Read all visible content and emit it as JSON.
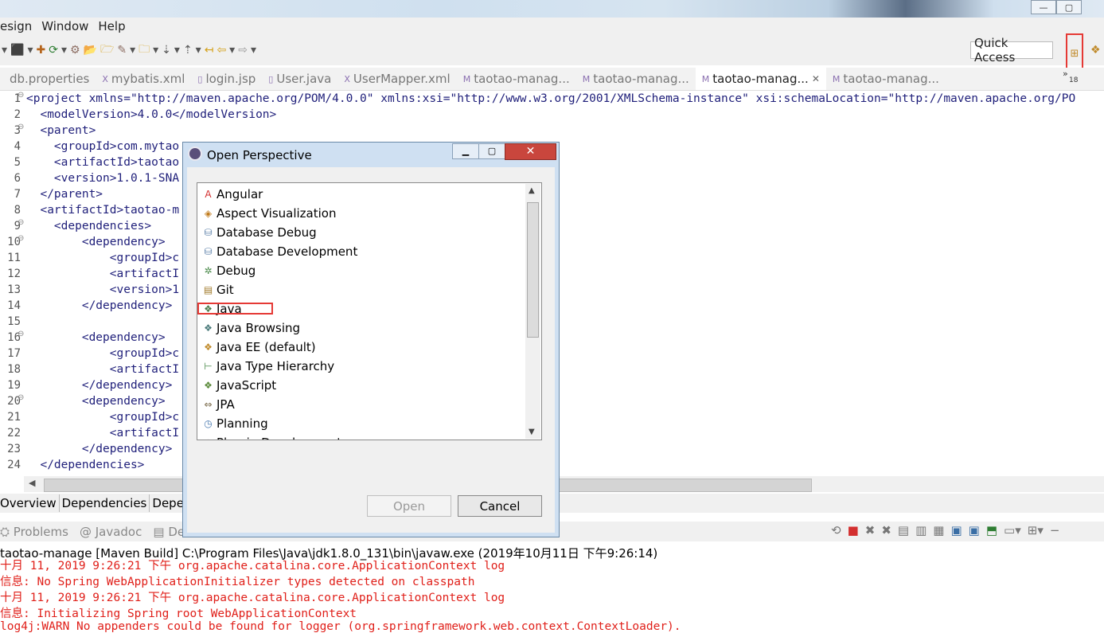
{
  "menu": [
    "esign",
    "Window",
    "Help"
  ],
  "quick_access": "Quick Access",
  "tabs": [
    {
      "label": "db.properties",
      "active": false
    },
    {
      "label": "mybatis.xml",
      "active": false
    },
    {
      "label": "login.jsp",
      "active": false
    },
    {
      "label": "User.java",
      "active": false
    },
    {
      "label": "UserMapper.xml",
      "active": false
    },
    {
      "label": "taotao-manag...",
      "active": false
    },
    {
      "label": "taotao-manag...",
      "active": false
    },
    {
      "label": "taotao-manag...",
      "active": true
    },
    {
      "label": "taotao-manag...",
      "active": false
    }
  ],
  "tab_overflow": "18",
  "editor": {
    "lines": [
      "1",
      "2",
      "3",
      "4",
      "5",
      "6",
      "7",
      "8",
      "9",
      "10",
      "11",
      "12",
      "13",
      "14",
      "15",
      "16",
      "17",
      "18",
      "19",
      "20",
      "21",
      "22",
      "23",
      "24"
    ],
    "code": [
      "<project xmlns=\"http://maven.apache.org/POM/4.0.0\" xmlns:xsi=\"http://www.w3.org/2001/XMLSchema-instance\" xsi:schemaLocation=\"http://maven.apache.org/PO",
      "  <modelVersion>4.0.0</modelVersion>",
      "  <parent>",
      "    <groupId>com.mytao",
      "    <artifactId>taotao",
      "    <version>1.0.1-SNA",
      "  </parent>",
      "  <artifactId>taotao-m",
      "    <dependencies>",
      "        <dependency>",
      "            <groupId>c",
      "            <artifactI",
      "            <version>1",
      "        </dependency>",
      "",
      "        <dependency>",
      "            <groupId>c",
      "            <artifactI",
      "        </dependency>",
      "        <dependency>",
      "            <groupId>c",
      "            <artifactI",
      "        </dependency>",
      "  </dependencies>"
    ]
  },
  "pom_tabs": [
    "Overview",
    "Dependencies",
    "Depe"
  ],
  "console_tabs": [
    "Problems",
    "Javadoc",
    "Dec"
  ],
  "console_title": "taotao-manage [Maven Build] C:\\Program Files\\Java\\jdk1.8.0_131\\bin\\javaw.exe (2019年10月11日 下午9:26:14)",
  "console_lines": [
    "十月 11, 2019 9:26:21 下午 org.apache.catalina.core.ApplicationContext log",
    "信息: No Spring WebApplicationInitializer types detected on classpath",
    "十月 11, 2019 9:26:21 下午 org.apache.catalina.core.ApplicationContext log",
    "信息: Initializing Spring root WebApplicationContext",
    "log4j:WARN No appenders could be found for logger (org.springframework.web.context.ContextLoader)."
  ],
  "dialog": {
    "title": "Open Perspective",
    "items": [
      {
        "label": "Angular",
        "icon": "angular-icon",
        "glyph": "A",
        "color": "#d32f2f"
      },
      {
        "label": "Aspect Visualization",
        "icon": "aspect-icon",
        "glyph": "◈",
        "color": "#c07a1a"
      },
      {
        "label": "Database Debug",
        "icon": "database-debug-icon",
        "glyph": "⛁",
        "color": "#5a7fa8"
      },
      {
        "label": "Database Development",
        "icon": "database-icon",
        "glyph": "⛁",
        "color": "#5a7fa8"
      },
      {
        "label": "Debug",
        "icon": "bug-icon",
        "glyph": "✲",
        "color": "#4a8a4a"
      },
      {
        "label": "Git",
        "icon": "git-icon",
        "glyph": "▤",
        "color": "#a07a2a"
      },
      {
        "label": "Java",
        "icon": "java-icon",
        "glyph": "❖",
        "color": "#4a7a4a"
      },
      {
        "label": "Java Browsing",
        "icon": "java-browsing-icon",
        "glyph": "❖",
        "color": "#4a7a7a"
      },
      {
        "label": "Java EE (default)",
        "icon": "javaee-icon",
        "glyph": "❖",
        "color": "#c08a2a"
      },
      {
        "label": "Java Type Hierarchy",
        "icon": "hierarchy-icon",
        "glyph": "⊢",
        "color": "#4a8a4a"
      },
      {
        "label": "JavaScript",
        "icon": "javascript-icon",
        "glyph": "❖",
        "color": "#5a8a3a"
      },
      {
        "label": "JPA",
        "icon": "jpa-icon",
        "glyph": "⇔",
        "color": "#7a6a4a"
      },
      {
        "label": "Planning",
        "icon": "planning-icon",
        "glyph": "◷",
        "color": "#4a7ab0"
      },
      {
        "label": "Plug-in Development",
        "icon": "plugin-icon",
        "glyph": "✦",
        "color": "#8a6a9a"
      }
    ],
    "open_label": "Open",
    "cancel_label": "Cancel"
  }
}
